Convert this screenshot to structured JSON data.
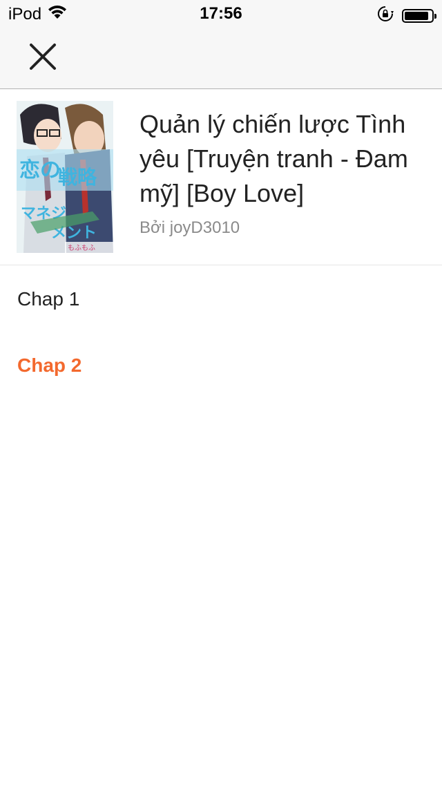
{
  "status_bar": {
    "carrier": "iPod",
    "time": "17:56",
    "battery_level": 0.9
  },
  "nav": {
    "close_icon": "close-icon"
  },
  "story": {
    "title": "Quản lý chiến lược Tình yêu [Truyện tranh - Đam mỹ] [Boy Love]",
    "author": "Bởi joyD3010"
  },
  "chapters": [
    {
      "label": "Chap 1",
      "active": false
    },
    {
      "label": "Chap 2",
      "active": true
    }
  ],
  "colors": {
    "accent": "#f3692e",
    "text": "#222222",
    "muted": "#8a8a8a",
    "bar_bg": "#f7f7f7"
  }
}
